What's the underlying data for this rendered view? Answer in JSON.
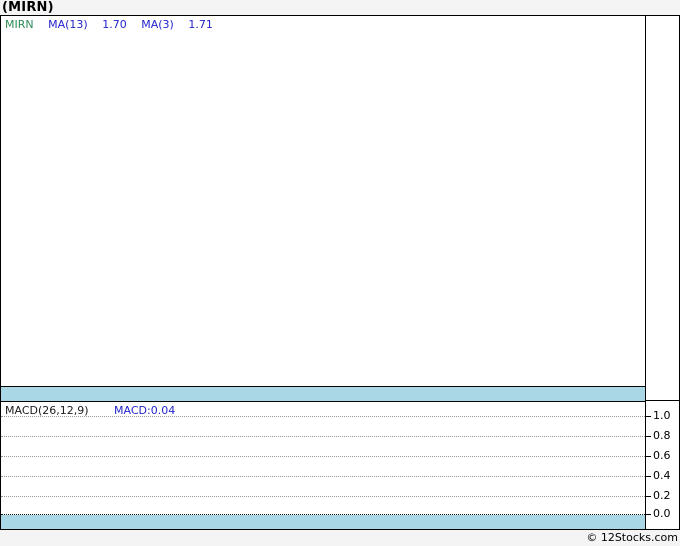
{
  "title": "(MIRN)",
  "colors": {
    "band": "#a9d7e5",
    "symbol_green": "#2e8b57",
    "indicator_blue": "#2424cc",
    "grid_gray": "#999999",
    "zero_line": "#111111",
    "border": "#000000",
    "panel_bg": "#ffffff",
    "page_bg": "#f4f4f4"
  },
  "price_panel": {
    "legend": {
      "symbol": "MIRN",
      "ma13_label": "MA(13)",
      "ma13_value": "1.70",
      "ma3_label": "MA(3)",
      "ma3_value": "1.71"
    }
  },
  "macd_panel": {
    "label": "MACD(26,12,9)",
    "value": "MACD:0.04",
    "axis_ticks": [
      "1.0",
      "0.8",
      "0.6",
      "0.4",
      "0.2",
      "0.0"
    ]
  },
  "footer": {
    "credit": "© 12Stocks.com"
  },
  "chart_data": [
    {
      "type": "line",
      "title": "(MIRN) price with moving averages",
      "series": [
        {
          "name": "MIRN",
          "color": "#2e8b57",
          "values": []
        },
        {
          "name": "MA(13)",
          "color": "#2424cc",
          "last_value": 1.7,
          "values": []
        },
        {
          "name": "MA(3)",
          "color": "#2424cc",
          "last_value": 1.71,
          "values": []
        }
      ],
      "grid": false,
      "legend_position": "top-left",
      "note": "plot area is empty - no visible data points drawn"
    },
    {
      "type": "line",
      "title": "MACD(26,12,9)",
      "series": [
        {
          "name": "MACD",
          "last_value": 0.04,
          "values": []
        }
      ],
      "yticks": [
        1.0,
        0.8,
        0.6,
        0.4,
        0.2,
        0.0
      ],
      "ylim": [
        -0.15,
        1.12
      ],
      "grid": true,
      "legend_position": "top-left",
      "note": "plot area is empty - no visible data points drawn; highlighted band below zero line"
    }
  ]
}
